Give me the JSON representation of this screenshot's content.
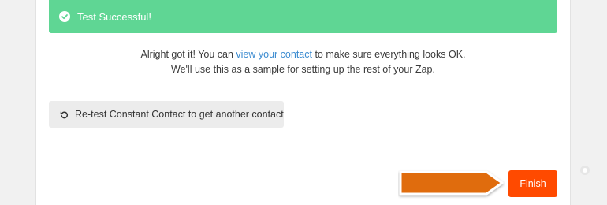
{
  "banner": {
    "text": "Test Successful!",
    "icon": "check-circle-icon",
    "color": "#5fd694"
  },
  "message": {
    "line1_before": "Alright got it! You can ",
    "line1_link": "view your contact",
    "line1_after": " to make sure everything looks OK.",
    "line2": "We'll use this as a sample for setting up the rest of your Zap.",
    "link_color": "#3b8bd0"
  },
  "retest_button": {
    "label": "Re-test Constant Contact to get another contact",
    "icon": "retry-icon"
  },
  "annotation": {
    "icon": "arrow-right-icon",
    "color": "#e06c10"
  },
  "finish_button": {
    "label": "Finish",
    "color": "#ff4a00"
  }
}
